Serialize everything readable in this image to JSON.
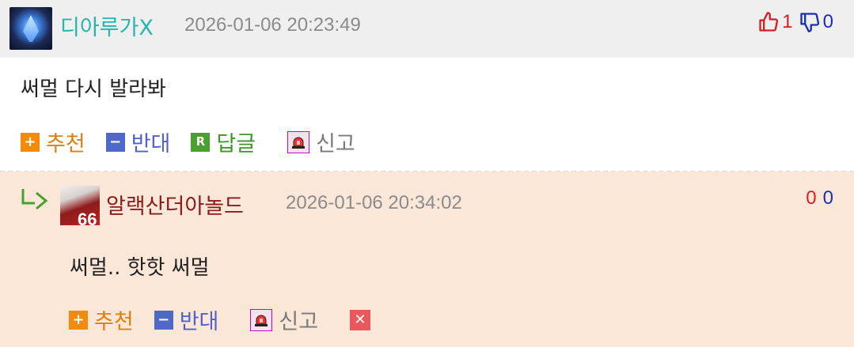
{
  "comments": [
    {
      "nickname": "디아루가X",
      "timestamp": "2026-01-06 20:23:49",
      "upvotes": "1",
      "downvotes": "0",
      "body": "써멀 다시 발라봐",
      "actions": {
        "recommend": "추천",
        "oppose": "반대",
        "reply": "답글",
        "report": "신고"
      },
      "icons": {
        "recommend": "+",
        "oppose": "−",
        "reply": "R"
      }
    },
    {
      "nickname": "알랙산더아놀드",
      "timestamp": "2026-01-06 20:34:02",
      "upvotes": "0",
      "downvotes": "0",
      "body": "써멀.. 핫핫 써멀",
      "actions": {
        "recommend": "추천",
        "oppose": "반대",
        "report": "신고"
      },
      "icons": {
        "recommend": "+",
        "oppose": "−",
        "delete": "✕"
      }
    }
  ],
  "colors": {
    "nickname_primary": "#27b6ab",
    "nickname_reply": "#8a1b1b",
    "upvote": "#d71f25",
    "downvote": "#1b2fb0",
    "recommend": "#f28a0c",
    "oppose": "#5068c8",
    "reply": "#48a02f",
    "reply_background": "#fbe7d8"
  }
}
